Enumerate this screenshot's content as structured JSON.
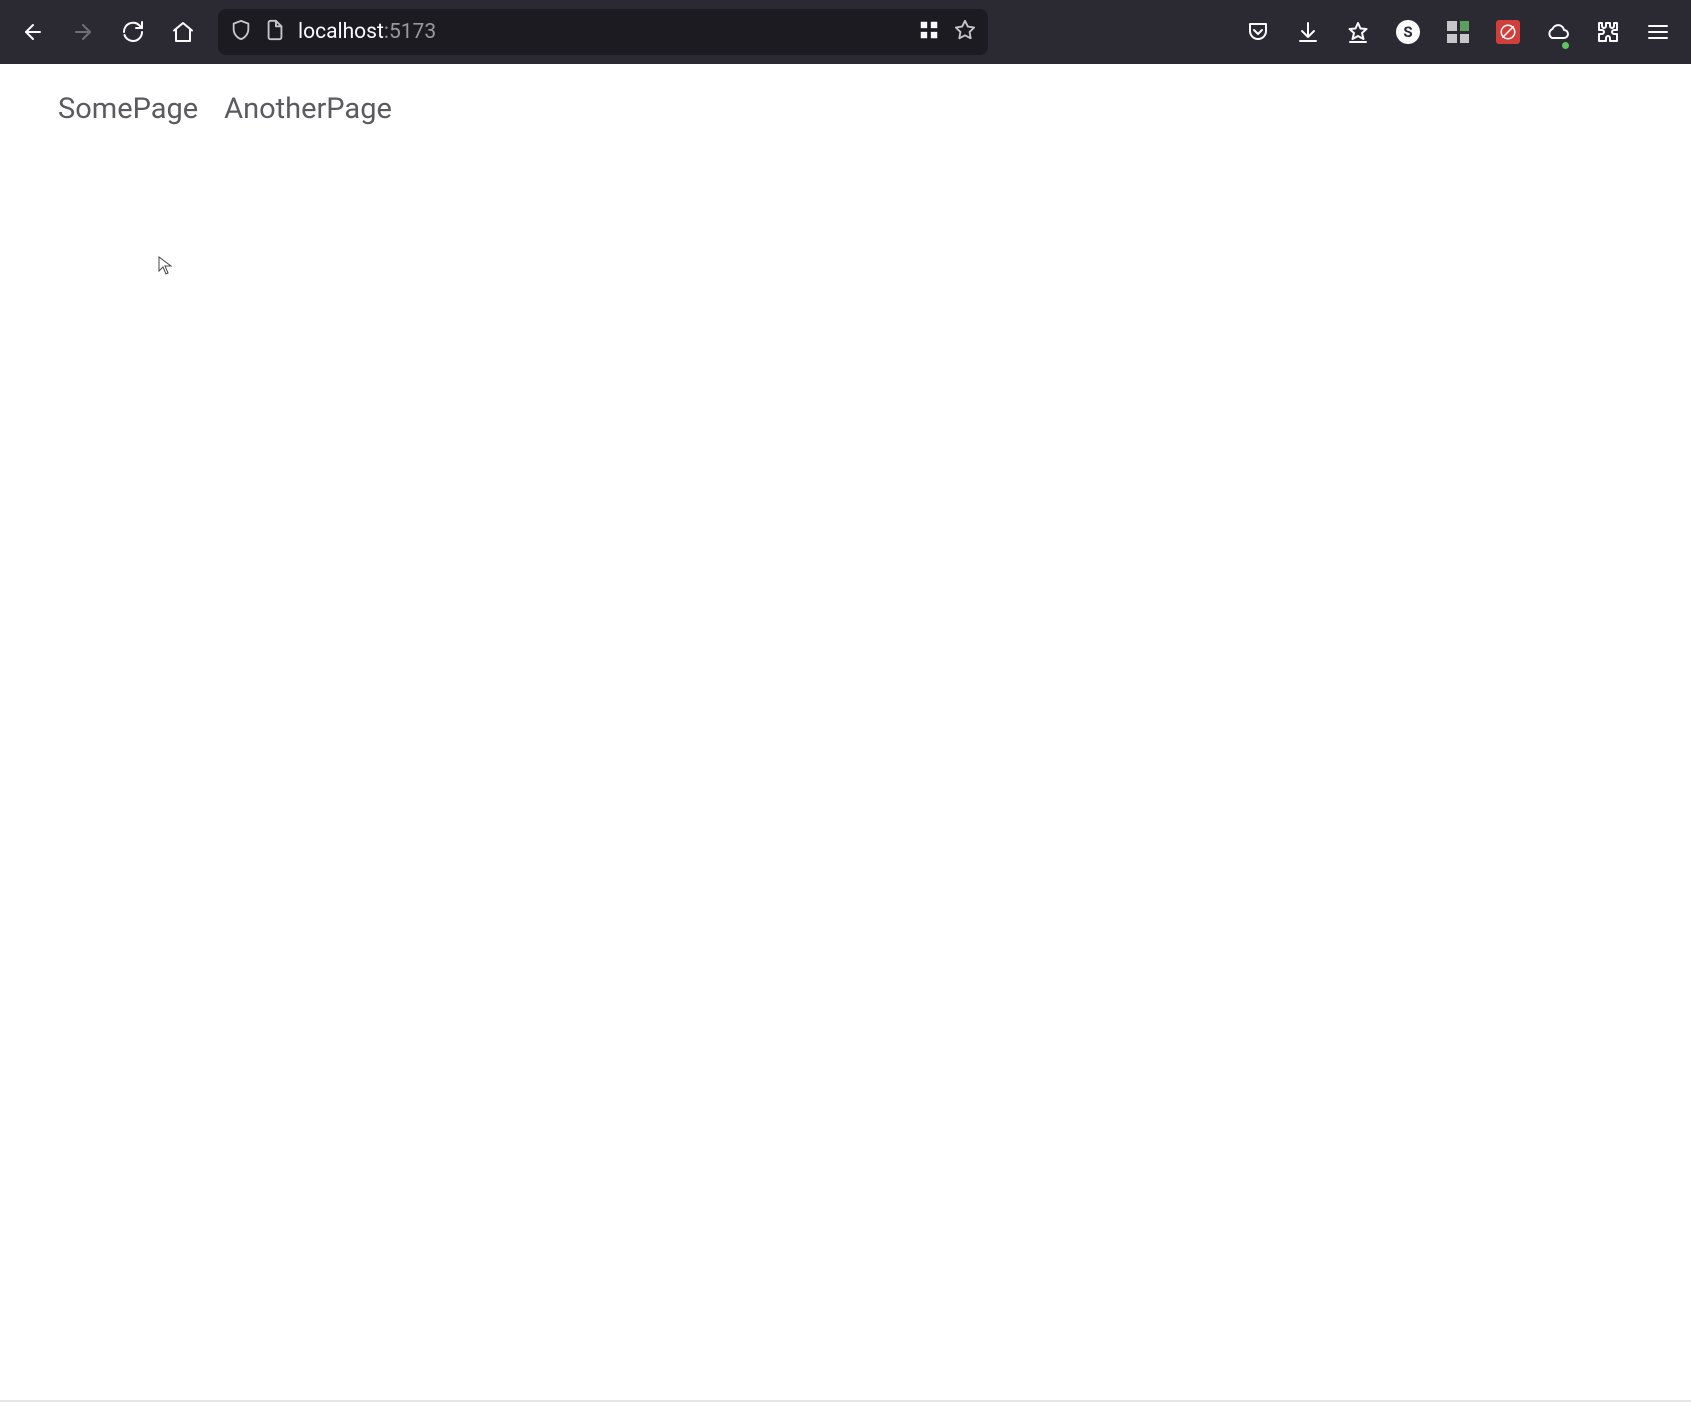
{
  "browser": {
    "url_host": "localhost",
    "url_port": ":5173"
  },
  "page": {
    "nav": [
      {
        "label": "SomePage"
      },
      {
        "label": "AnotherPage"
      }
    ]
  }
}
